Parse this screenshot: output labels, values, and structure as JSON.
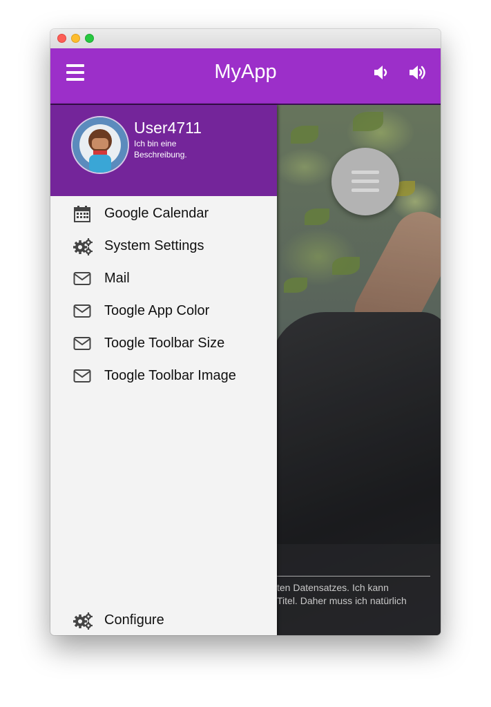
{
  "window": {
    "traffic_lights": [
      "close",
      "minimize",
      "zoom"
    ]
  },
  "toolbar": {
    "title": "MyApp",
    "background_color": "#9c2fc9",
    "left_icon": "hamburger-menu-icon",
    "right_icons": [
      "volume-down-icon",
      "volume-up-icon"
    ]
  },
  "drawer": {
    "header_color": "#74259a",
    "user": {
      "name": "User4711",
      "description": "Ich bin eine Beschreibung."
    },
    "items": [
      {
        "label": "Google Calendar",
        "icon": "calendar-icon"
      },
      {
        "label": "System Settings",
        "icon": "gears-icon"
      },
      {
        "label": "Mail",
        "icon": "envelope-icon"
      },
      {
        "label": "Toogle App Color",
        "icon": "envelope-icon"
      },
      {
        "label": "Toogle Toolbar Size",
        "icon": "envelope-icon"
      },
      {
        "label": "Toogle Toolbar Image",
        "icon": "envelope-icon"
      }
    ],
    "footer_item": {
      "label": "Configure",
      "icon": "gears-icon"
    }
  },
  "content": {
    "fab_icon": "hamburger-menu-icon",
    "caption_line1": "ten Datensatzes. Ich kann",
    "caption_line2": "Titel. Daher muss ich natürlich"
  }
}
